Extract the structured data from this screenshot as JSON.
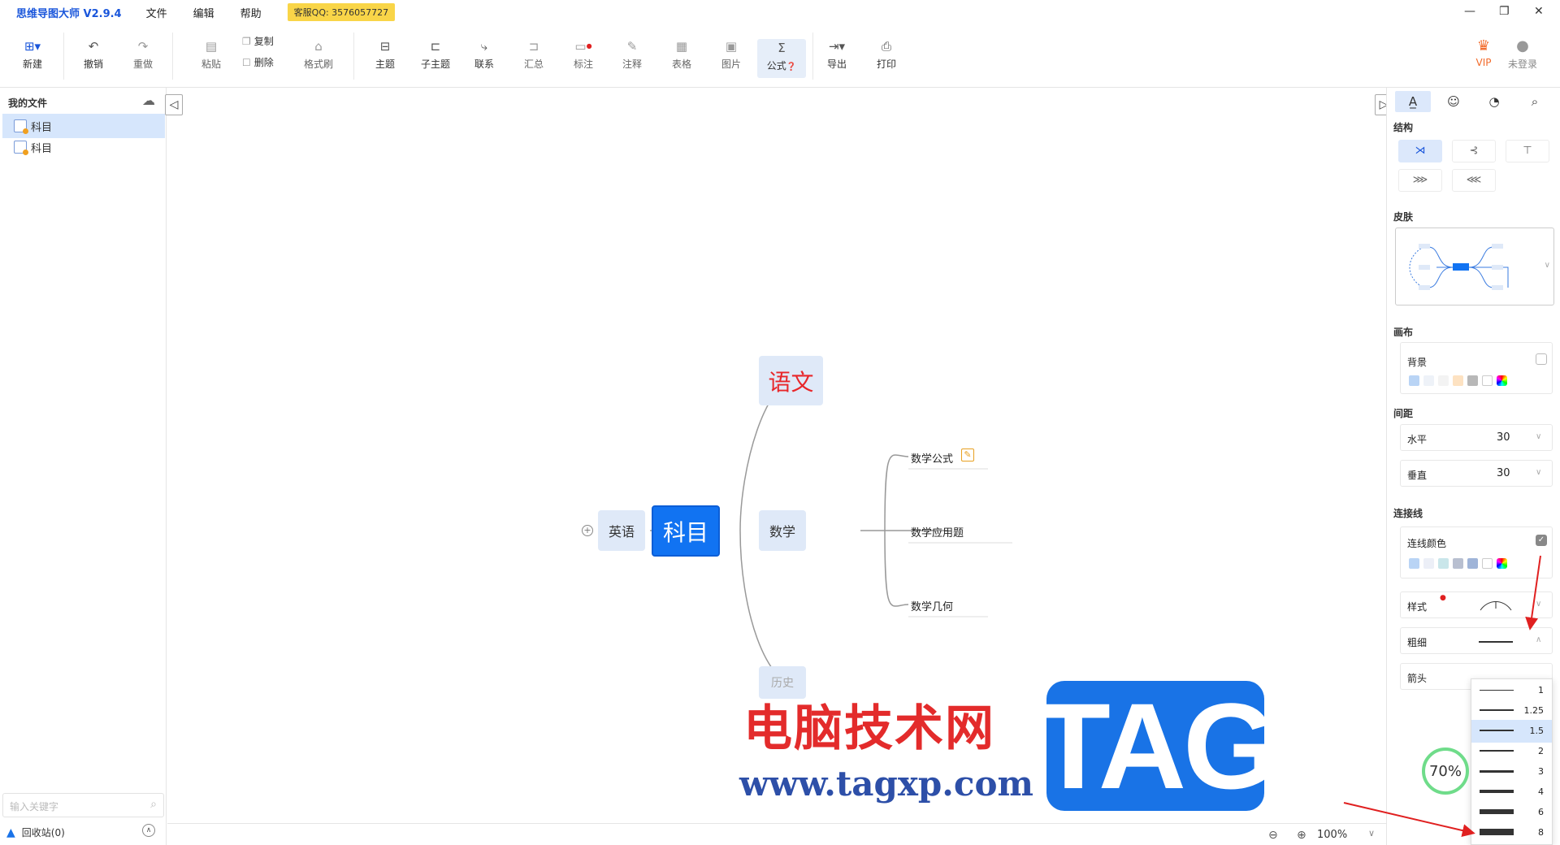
{
  "titlebar": {
    "app_title": "思维导图大师 V2.9.4",
    "menus": [
      "文件",
      "编辑",
      "帮助"
    ],
    "qq_badge": "客服QQ: 3576057727"
  },
  "toolbar": {
    "new": "新建",
    "undo": "撤销",
    "redo": "重做",
    "paste": "粘贴",
    "copy": "复制",
    "delete": "删除",
    "format_brush": "格式刷",
    "topic": "主题",
    "subtopic": "子主题",
    "relation": "联系",
    "summary": "汇总",
    "mark": "标注",
    "note": "注释",
    "table": "表格",
    "image": "图片",
    "formula": "公式",
    "export": "导出",
    "print": "打印",
    "vip": "VIP",
    "login": "未登录"
  },
  "left_panel": {
    "title": "我的文件",
    "files": [
      "科目",
      "科目"
    ],
    "search_placeholder": "输入关键字",
    "recycle": "回收站(0)"
  },
  "mindmap": {
    "root": "科目",
    "left_child": "英语",
    "children": [
      "语文",
      "数学",
      "历史"
    ],
    "math_children": [
      "数学公式",
      "数学应用题",
      "数学几何"
    ]
  },
  "status": {
    "zoom": "100%"
  },
  "right_panel": {
    "structure_label": "结构",
    "skin_label": "皮肤",
    "canvas_label": "画布",
    "background_label": "背景",
    "spacing_label": "间距",
    "horizontal_label": "水平",
    "horizontal_value": "30",
    "vertical_label": "垂直",
    "vertical_value": "30",
    "line_label": "连接线",
    "line_color_label": "连线颜色",
    "style_label": "样式",
    "thickness_label": "粗细",
    "arrow_label": "箭头",
    "bg_colors": [
      "#b9d4f5",
      "#eef2f8",
      "#f3f3f3",
      "#fde2c2",
      "#b8b8b8",
      "#ffffff"
    ],
    "line_colors": [
      "#b9d4f5",
      "#eceff7",
      "#c9e6ea",
      "#b8bfd0",
      "#9fb4d8",
      "#ffffff"
    ]
  },
  "thickness_dropdown": {
    "options": [
      {
        "label": "1",
        "weight": 1
      },
      {
        "label": "1.25",
        "weight": 1.25
      },
      {
        "label": "1.5",
        "weight": 1.5
      },
      {
        "label": "2",
        "weight": 2
      },
      {
        "label": "3",
        "weight": 3
      },
      {
        "label": "4",
        "weight": 4
      },
      {
        "label": "6",
        "weight": 6
      },
      {
        "label": "8",
        "weight": 8
      }
    ],
    "selected": "1.5"
  },
  "progress_badge": "70%",
  "watermark": {
    "title": "电脑技术网",
    "url": "www.tagxp.com",
    "tag": "TAG"
  },
  "colors": {
    "accent": "#1a56db",
    "root_node": "#1173f2",
    "node_bg": "#dfe9f8",
    "red_text": "#e8262a"
  }
}
